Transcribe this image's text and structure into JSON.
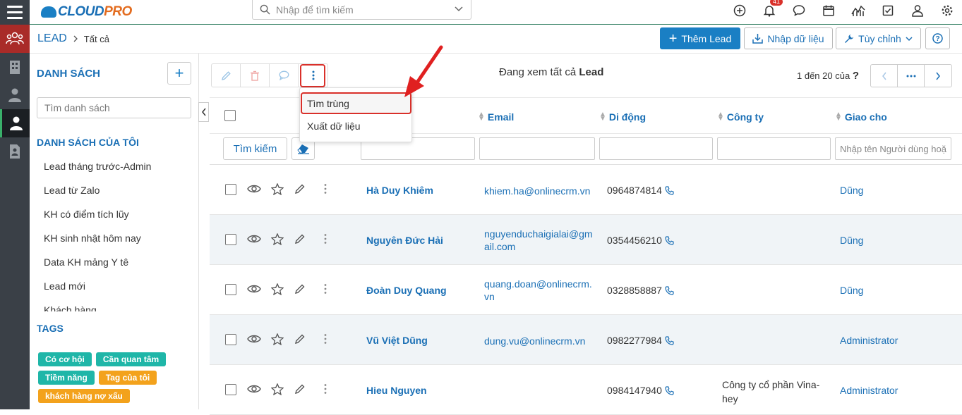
{
  "app": {
    "logo_prefix": "CLOUD",
    "logo_suffix": "PRO"
  },
  "header": {
    "search_placeholder": "Nhập để tìm kiếm",
    "notification_count": "41",
    "icons": [
      "add-circle-icon",
      "bell-icon",
      "chat-icon",
      "calendar-icon",
      "chart-icon",
      "task-check-icon",
      "user-icon",
      "gear-icon"
    ]
  },
  "leftnav": {
    "items": [
      "leads-group-icon",
      "building-icon",
      "contacts-icon",
      "person-icon",
      "document-icon"
    ]
  },
  "breadcrumb": {
    "module": "LEAD",
    "current": "Tất cả"
  },
  "actions": {
    "add_lead": "Thêm Lead",
    "import": "Nhập dữ liệu",
    "customize": "Tùy chỉnh"
  },
  "sidebar": {
    "list_title": "DANH SÁCH",
    "search_placeholder": "Tìm danh sách",
    "my_lists_title": "DANH SÁCH CỦA TÔI",
    "my_lists": [
      "Lead tháng trước-Admin",
      "Lead từ Zalo",
      "KH có điểm tích lũy",
      "KH sinh nhật hôm nay",
      "Data KH mảng Y tê",
      "Lead mới",
      "Khách hàng"
    ],
    "tags_title": "TAGS",
    "tags": [
      {
        "label": "Có cơ hội",
        "color": "#1fb6a8"
      },
      {
        "label": "Cần quan tâm",
        "color": "#1fb6a8"
      },
      {
        "label": "Tiềm năng",
        "color": "#1fb6a8"
      },
      {
        "label": "Tag của tôi",
        "color": "#f3a21c"
      },
      {
        "label": "khách hàng nợ xấu",
        "color": "#f3a21c"
      }
    ]
  },
  "list": {
    "viewing_prefix": "Đang xem tất cả",
    "viewing_module": "Lead",
    "pager_text": "1 đến 20 của",
    "pager_help": "?",
    "more_menu": [
      "Tìm trùng",
      "Xuất dữ liệu"
    ],
    "columns": {
      "email": "Email",
      "mobile": "Di động",
      "company": "Công ty",
      "assigned": "Giao cho"
    },
    "filters": {
      "search_button": "Tìm kiếm",
      "assigned_placeholder": "Nhập tên Người dùng hoặc Nhóm"
    },
    "rows": [
      {
        "name": "Hà Duy Khiêm",
        "email": "khiem.ha@onlinecrm.vn",
        "phone": "0964874814",
        "company": "",
        "owner": "Dũng"
      },
      {
        "name": "Nguyên Đức Hải",
        "email": "nguyenduchaigialai@gmail.com",
        "phone": "0354456210",
        "company": "",
        "owner": "Dũng"
      },
      {
        "name": "Đoàn Duy Quang",
        "email": "quang.doan@onlinecrm.vn",
        "phone": "0328858887",
        "company": "",
        "owner": "Dũng"
      },
      {
        "name": "Vũ Việt Dũng",
        "email": "dung.vu@onlinecrm.vn",
        "phone": "0982277984",
        "company": "",
        "owner": "Administrator"
      },
      {
        "name": "Hieu Nguyen",
        "email": "",
        "phone": "0984147940",
        "company": "Công ty cổ phần Vina-hey",
        "owner": "Administrator"
      }
    ]
  },
  "colors": {
    "primary": "#1a7fc4",
    "link": "#1a6fb5",
    "highlight": "#d9302a",
    "sidebar_bg": "#3a4047"
  }
}
